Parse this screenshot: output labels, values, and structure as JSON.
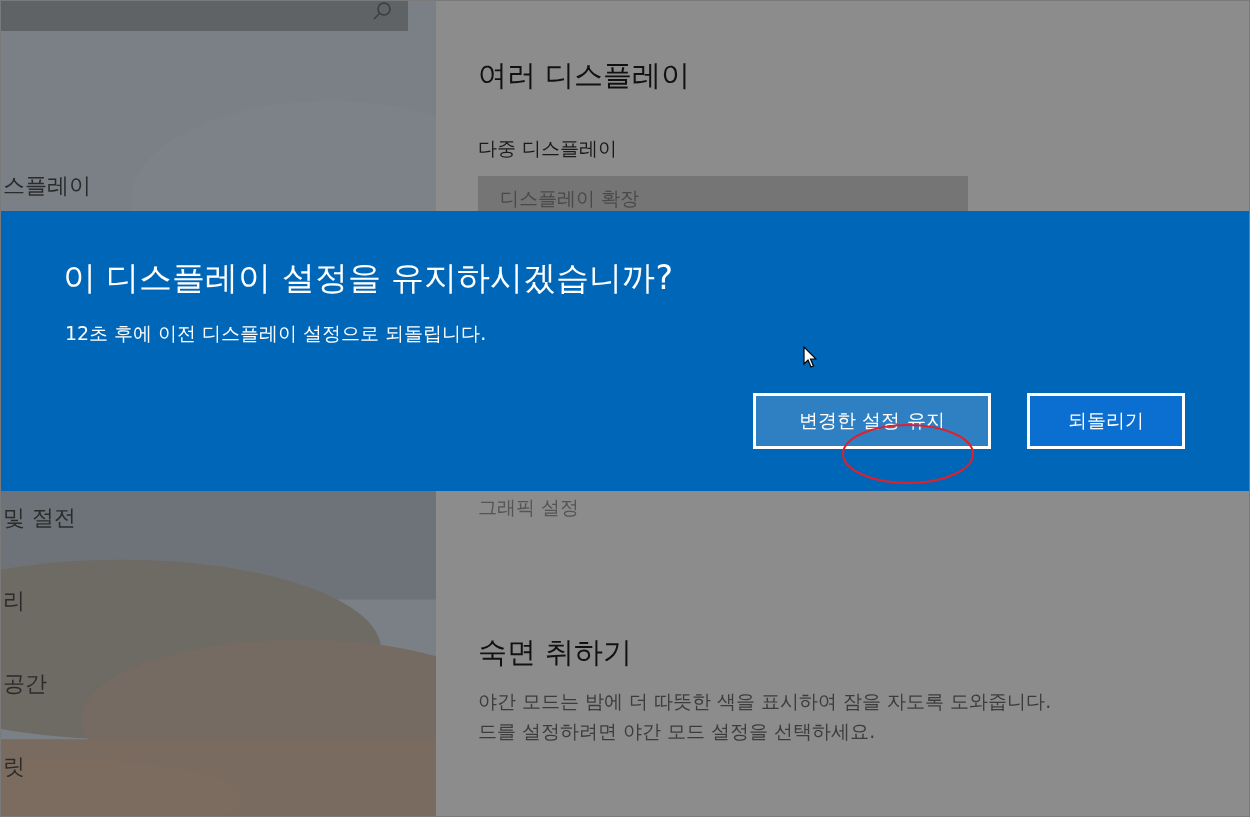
{
  "sidebar": {
    "search": {
      "kind": "search"
    },
    "items": [
      {
        "label": "스플레이"
      },
      {
        "label": "및 절전"
      },
      {
        "label": "리"
      },
      {
        "label": "공간"
      },
      {
        "label": "릿"
      }
    ]
  },
  "content": {
    "heading": "여러 디스플레이",
    "field_label": "다중 디스플레이",
    "dropdown": {
      "value": "디스플레이 확장"
    },
    "link": "그래픽 설정",
    "section_heading": "숙면 취하기",
    "paragraph_lines": [
      "야간 모드는 밤에 더 따뜻한 색을 표시하여 잠을 자도록 도와줍니다.",
      "드를 설정하려면 야간 모드 설정을 선택하세요."
    ]
  },
  "dialog": {
    "title": "이 디스플레이 설정을 유지하시겠습니까?",
    "message": "12초 후에 이전 디스플레이 설정으로 되돌립니다.",
    "buttons": [
      {
        "label": "변경한 설정 유지",
        "selected": true,
        "annotated": true
      },
      {
        "label": "되돌리기",
        "selected": false,
        "annotated": false
      }
    ]
  }
}
